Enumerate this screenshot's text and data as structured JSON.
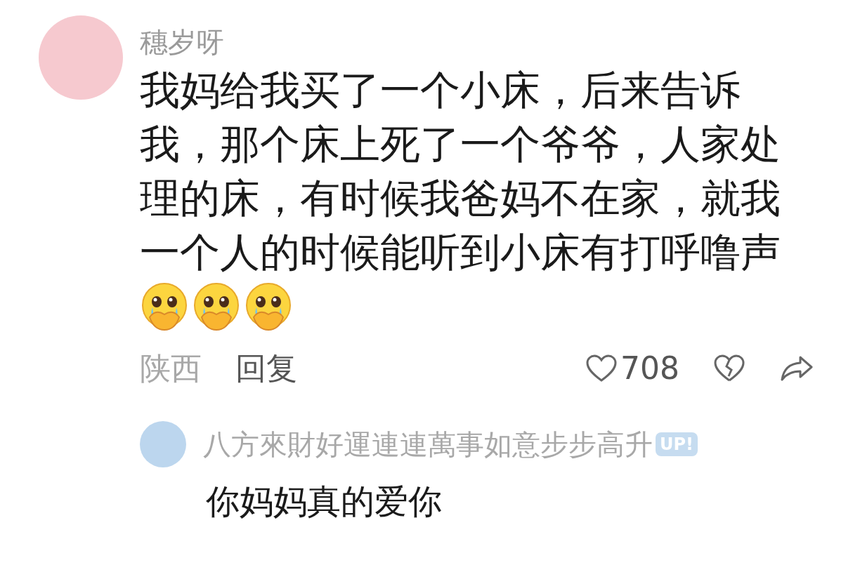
{
  "comment": {
    "author": "穗岁呀",
    "text": "我妈给我买了一个小床，后来告诉我，那个床上死了一个爷爷，人家处理的床，有时候我爸妈不在家，就我一个人的时候能听到小床有打呼噜声",
    "emojis": [
      {
        "kind": "crying-hands"
      },
      {
        "kind": "crying-hands"
      },
      {
        "kind": "crying-hands"
      }
    ],
    "location": "陕西",
    "reply_label": "回复",
    "likes": "708"
  },
  "reply": {
    "author": "八方來財好運連連萬事如意步步高升",
    "badge": "UP!",
    "text": "你妈妈真的爱你"
  }
}
